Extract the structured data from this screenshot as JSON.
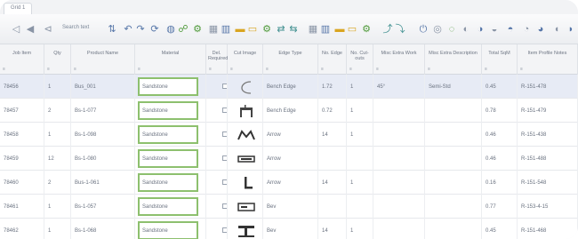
{
  "window": {
    "tab_label": "Grid 1"
  },
  "toolbar": {
    "filter_text": "Search text",
    "icons": [
      {
        "name": "first-record-icon",
        "glyph": "◁",
        "tone": "gray"
      },
      {
        "name": "previous-record-icon",
        "glyph": "◀",
        "tone": "gray"
      },
      {
        "name": "filter-icon",
        "glyph": "⊲",
        "tone": "gray"
      },
      {
        "name": "sort-icon",
        "glyph": "⇅",
        "tone": "blue"
      },
      {
        "name": "back-icon",
        "glyph": "↶",
        "tone": "blue"
      },
      {
        "name": "forward-icon",
        "glyph": "↷",
        "tone": "blue"
      },
      {
        "name": "refresh-icon",
        "glyph": "⟳",
        "tone": "blue"
      },
      {
        "name": "globe-icon",
        "glyph": "◍",
        "tone": "blue"
      },
      {
        "name": "link-icon",
        "glyph": "☍",
        "tone": "green"
      },
      {
        "name": "settings-icon",
        "glyph": "⚙",
        "tone": "green"
      },
      {
        "name": "table-icon",
        "glyph": "▦",
        "tone": "gray"
      },
      {
        "name": "columns-icon",
        "glyph": "▥",
        "tone": "blue"
      },
      {
        "name": "folder-icon",
        "glyph": "▬",
        "tone": "gold"
      },
      {
        "name": "folder-open-icon",
        "glyph": "▭",
        "tone": "gold"
      },
      {
        "name": "gear-icon",
        "glyph": "⚙",
        "tone": "green"
      },
      {
        "name": "merge-icon",
        "glyph": "⇄",
        "tone": "teal"
      },
      {
        "name": "split-icon",
        "glyph": "⇆",
        "tone": "teal"
      },
      {
        "name": "table-alt-icon",
        "glyph": "▦",
        "tone": "gray"
      },
      {
        "name": "columns-alt-icon",
        "glyph": "▥",
        "tone": "blue"
      },
      {
        "name": "folder-alt-icon",
        "glyph": "▬",
        "tone": "gold"
      },
      {
        "name": "folder-open-alt-icon",
        "glyph": "▭",
        "tone": "gold"
      },
      {
        "name": "gear-alt-icon",
        "glyph": "⚙",
        "tone": "green"
      },
      {
        "name": "export-icon",
        "glyph": "⤴",
        "tone": "teal"
      },
      {
        "name": "import-icon",
        "glyph": "⤵",
        "tone": "teal"
      },
      {
        "name": "power-icon",
        "glyph": "⏻",
        "tone": "blue"
      },
      {
        "name": "help-icon",
        "glyph": "◎",
        "tone": "gray"
      },
      {
        "name": "info-icon",
        "glyph": "◌",
        "tone": "green"
      }
    ]
  },
  "grid": {
    "columns": [
      {
        "label": "Job Item",
        "filter": "≡"
      },
      {
        "label": "Qty",
        "filter": "≡"
      },
      {
        "label": "Product Name",
        "filter": "≡"
      },
      {
        "label": "Material",
        "filter": "≡"
      },
      {
        "label": "Del. Required",
        "filter": "≡"
      },
      {
        "label": "Cut Image",
        "filter": "≡"
      },
      {
        "label": "Edge Type",
        "filter": "≡"
      },
      {
        "label": "No. Edge",
        "filter": "≡"
      },
      {
        "label": "No. Cut-outs",
        "filter": "≡"
      },
      {
        "label": "Misc Extra Work",
        "filter": "≡"
      },
      {
        "label": "Misc Extra Description",
        "filter": "≡"
      },
      {
        "label": "Total SqM",
        "filter": "≡"
      },
      {
        "label": "Item Profile Notes",
        "filter": "≡"
      }
    ],
    "rows": [
      {
        "item": "78456",
        "qty": "1",
        "product": "Bus_001",
        "material": "Sandstone",
        "edge": "Bench Edge",
        "n_edge": "1.72",
        "cutouts": "1",
        "extra": "45°",
        "extra_desc": "Semi-Std",
        "sqm": "0.45",
        "notes": "R-151-478",
        "selected": true
      },
      {
        "item": "78457",
        "qty": "2",
        "product": "Bs-1-077",
        "material": "Sandstone",
        "edge": "Bench Edge",
        "n_edge": "0.72",
        "cutouts": "1",
        "extra": "",
        "extra_desc": "",
        "sqm": "0.78",
        "notes": "R-151-479",
        "selected": false
      },
      {
        "item": "78458",
        "qty": "1",
        "product": "Bs-1-098",
        "material": "Sandstone",
        "edge": "Arrow",
        "n_edge": "14",
        "cutouts": "1",
        "extra": "",
        "extra_desc": "",
        "sqm": "0.46",
        "notes": "R-151-438",
        "selected": false
      },
      {
        "item": "78459",
        "qty": "12",
        "product": "Bs-1-080",
        "material": "Sandstone",
        "edge": "Arrow",
        "n_edge": "",
        "cutouts": "",
        "extra": "",
        "extra_desc": "",
        "sqm": "0.46",
        "notes": "R-151-488",
        "selected": false
      },
      {
        "item": "78460",
        "qty": "2",
        "product": "Bus-1-061",
        "material": "Sandstone",
        "edge": "Arrow",
        "n_edge": "14",
        "cutouts": "1",
        "extra": "",
        "extra_desc": "",
        "sqm": "0.16",
        "notes": "R-151-548",
        "selected": false
      },
      {
        "item": "78461",
        "qty": "1",
        "product": "Bs-1-057",
        "material": "Sandstone",
        "edge": "Bev",
        "n_edge": "",
        "cutouts": "",
        "extra": "",
        "extra_desc": "",
        "sqm": "0.77",
        "notes": "R-153-4-15",
        "selected": false
      },
      {
        "item": "78462",
        "qty": "1",
        "product": "Bs-1-068",
        "material": "Sandstone",
        "edge": "Bev",
        "n_edge": "14",
        "cutouts": "1",
        "extra": "",
        "extra_desc": "",
        "sqm": "0.45",
        "notes": "R-151-468",
        "selected": false
      }
    ]
  }
}
